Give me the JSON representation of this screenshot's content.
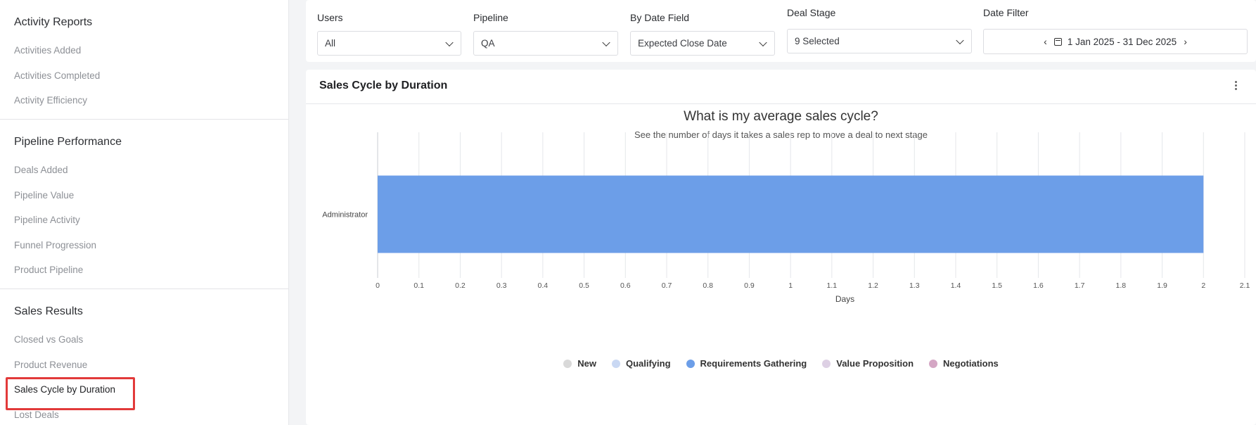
{
  "sidebar": {
    "sections": [
      {
        "title": "Activity Reports",
        "items": [
          "Activities Added",
          "Activities Completed",
          "Activity Efficiency"
        ]
      },
      {
        "title": "Pipeline Performance",
        "items": [
          "Deals Added",
          "Pipeline Value",
          "Pipeline Activity",
          "Funnel Progression",
          "Product Pipeline"
        ]
      },
      {
        "title": "Sales Results",
        "items": [
          "Closed vs Goals",
          "Product Revenue",
          "Sales Cycle by Duration",
          "Lost Deals"
        ]
      }
    ],
    "active_item": "Sales Cycle by Duration"
  },
  "filters": {
    "users": {
      "label": "Users",
      "value": "All"
    },
    "pipeline": {
      "label": "Pipeline",
      "value": "QA"
    },
    "date_field": {
      "label": "By Date Field",
      "value": "Expected Close Date"
    },
    "deal_stage": {
      "label": "Deal Stage",
      "value": "9 Selected"
    },
    "date_filter": {
      "label": "Date Filter",
      "value": "1 Jan 2025 - 31 Dec 2025"
    }
  },
  "card": {
    "title": "Sales Cycle by Duration",
    "menu_icon": "kebab-vertical-icon"
  },
  "chart_data": {
    "type": "bar",
    "orientation": "horizontal",
    "title": "What is my average sales cycle?",
    "subtitle": "See the number of days it takes a sales rep to move a deal to next stage",
    "categories": [
      "Administrator"
    ],
    "series": [
      {
        "name": "New",
        "color": "#d9d9d9",
        "values": [
          0
        ]
      },
      {
        "name": "Qualifying",
        "color": "#c9d8f3",
        "values": [
          0
        ]
      },
      {
        "name": "Requirements Gathering",
        "color": "#6c9ee8",
        "values": [
          2
        ]
      },
      {
        "name": "Value Proposition",
        "color": "#ddd0e4",
        "values": [
          0
        ]
      },
      {
        "name": "Negotiations",
        "color": "#d4a6c4",
        "values": [
          0
        ]
      }
    ],
    "xlabel": "Days",
    "xlim": [
      0,
      2.1
    ],
    "xticks": [
      "0",
      "0.1",
      "0.2",
      "0.3",
      "0.4",
      "0.5",
      "0.6",
      "0.7",
      "0.8",
      "0.9",
      "1",
      "1.1",
      "1.2",
      "1.3",
      "1.4",
      "1.5",
      "1.6",
      "1.7",
      "1.8",
      "1.9",
      "2",
      "2.1"
    ],
    "grid": true,
    "legend": "bottom-center"
  }
}
